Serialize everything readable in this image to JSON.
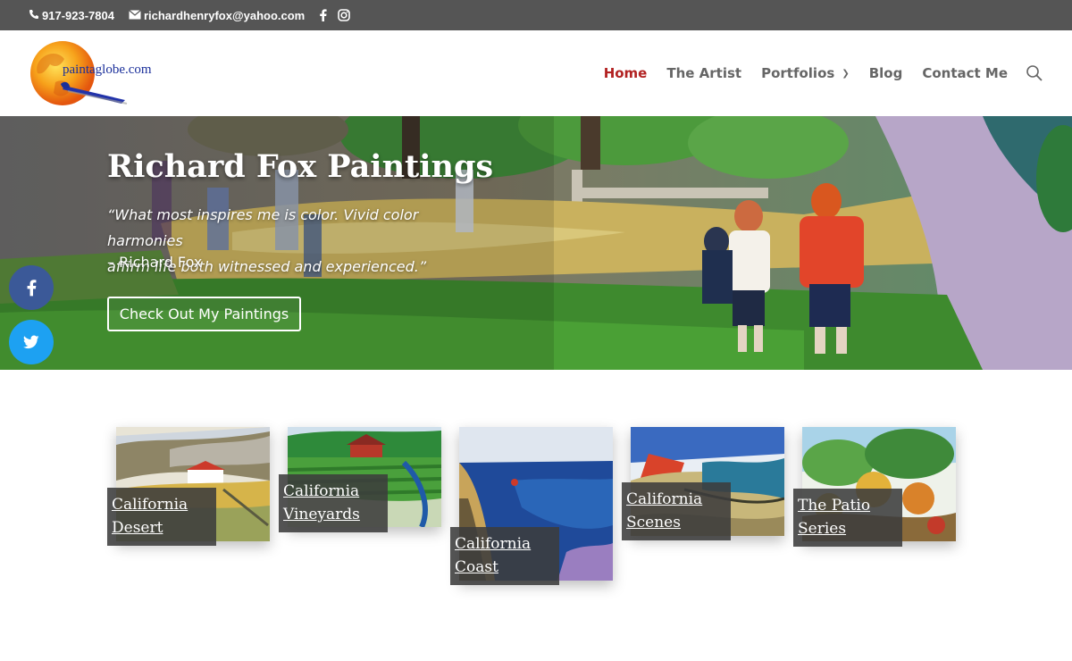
{
  "topbar": {
    "phone": "917-923-7804",
    "email": "richardhenryfox@yahoo.com",
    "social_icons": [
      "facebook-icon",
      "instagram-icon"
    ]
  },
  "header": {
    "logo_text": "paintaglobe.com",
    "nav": [
      {
        "label": "Home",
        "active": true
      },
      {
        "label": "The Artist",
        "active": false
      },
      {
        "label": "Portfolios",
        "active": false,
        "has_dropdown": true
      },
      {
        "label": "Blog",
        "active": false
      },
      {
        "label": "Contact Me",
        "active": false
      }
    ],
    "active_color": "#b22222"
  },
  "hero": {
    "title": "Richard Fox Paintings",
    "quote_line1": "“What most inspires me is color. Vivid color harmonies",
    "quote_line2": "affirm life both witnessed and experienced.”",
    "author": "– Richard Fox",
    "button": "Check Out My Paintings"
  },
  "floating_social": [
    "facebook-icon",
    "twitter-icon"
  ],
  "portfolios": [
    {
      "line1": "California",
      "line2": "Desert"
    },
    {
      "line1": "California",
      "line2": "Vineyards"
    },
    {
      "line1": "California",
      "line2": "Coast"
    },
    {
      "line1": "California",
      "line2": "Scenes"
    },
    {
      "line1": "The Patio",
      "line2": "Series"
    }
  ],
  "colors": {
    "topbar": "#555555",
    "facebook": "#3b5998",
    "twitter": "#1da1f2"
  }
}
